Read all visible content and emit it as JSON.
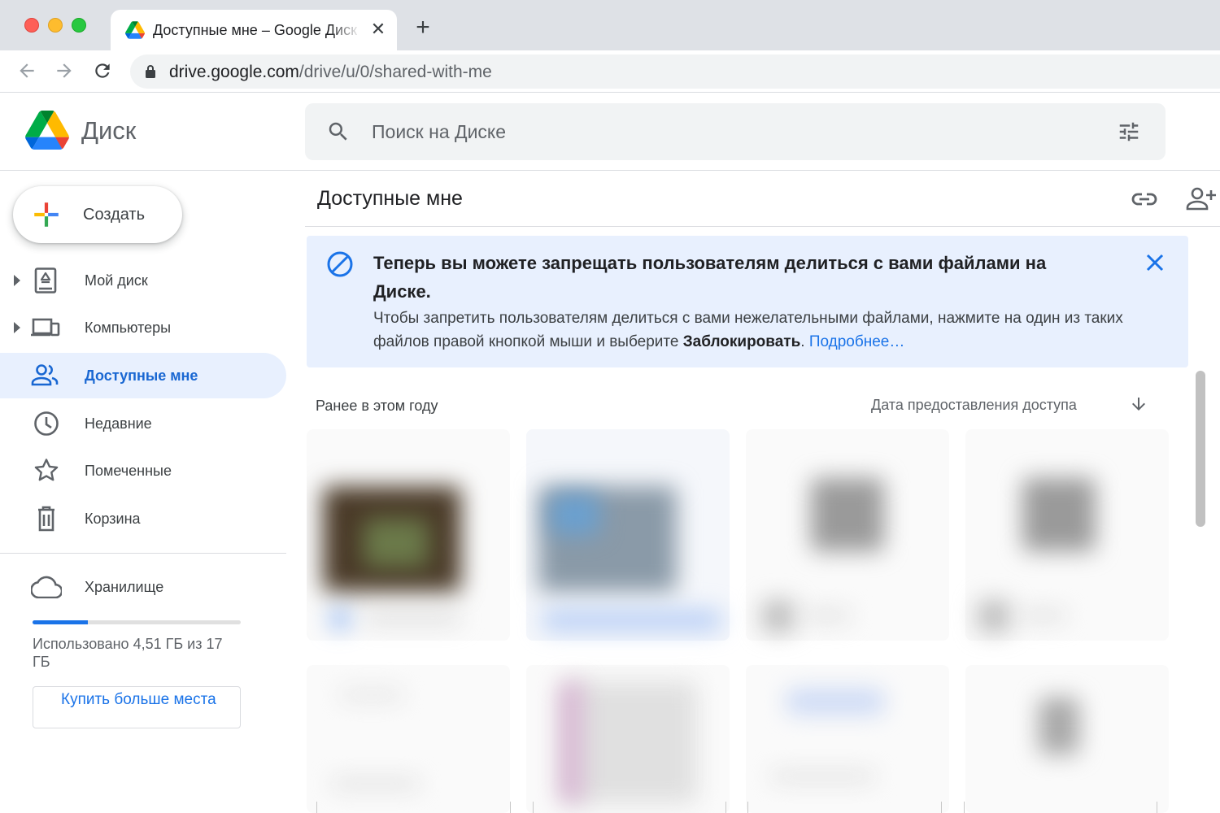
{
  "browser": {
    "tab_title": "Доступные мне – Google Диск",
    "tab_close": "✕",
    "new_tab": "+",
    "url_host": "drive.google.com",
    "url_path": "/drive/u/0/shared-with-me"
  },
  "app": {
    "name": "Диск",
    "search_placeholder": "Поиск на Диске"
  },
  "sidebar": {
    "create_label": "Создать",
    "items": [
      {
        "label": "Мой диск",
        "icon": "my-drive-icon",
        "expandable": true,
        "active": false
      },
      {
        "label": "Компьютеры",
        "icon": "computers-icon",
        "expandable": true,
        "active": false
      },
      {
        "label": "Доступные мне",
        "icon": "shared-people-icon",
        "expandable": false,
        "active": true
      },
      {
        "label": "Недавние",
        "icon": "clock-icon",
        "expandable": false,
        "active": false
      },
      {
        "label": "Помеченные",
        "icon": "star-icon",
        "expandable": false,
        "active": false
      },
      {
        "label": "Корзина",
        "icon": "trash-icon",
        "expandable": false,
        "active": false
      }
    ],
    "storage": {
      "label": "Хранилище",
      "used_text": "Использовано 4,51 ГБ из 17 ГБ",
      "used_fraction": 0.265,
      "buy_label": "Купить больше места"
    }
  },
  "main": {
    "title": "Доступные мне",
    "banner": {
      "title": "Теперь вы можете запрещать пользователям делиться с вами файлами на Диске.",
      "text_before": "Чтобы запретить пользователям делиться с вами нежелательными файлами, нажмите на один из таких файлов правой кнопкой мыши и выберите ",
      "text_bold": "Заблокировать",
      "text_after": ". ",
      "link": "Подробнее…"
    },
    "section_label": "Ранее в этом году",
    "sort_label": "Дата предоставления доступа"
  },
  "colors": {
    "accent": "#1a73e8",
    "active_bg": "#e8f0fe",
    "banner_bg": "#e8f0fe"
  }
}
